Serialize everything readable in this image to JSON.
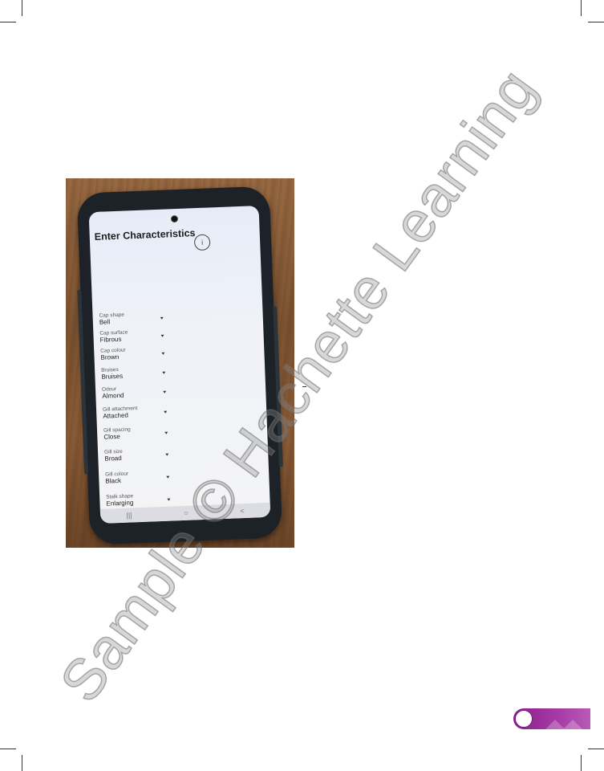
{
  "phone_screen": {
    "title": "Enter Characteristics",
    "info_icon": "info-icon",
    "fields": [
      {
        "label": "Cap shape",
        "value": "Bell"
      },
      {
        "label": "Cap surface",
        "value": "Fibrous"
      },
      {
        "label": "Cap colour",
        "value": "Brown"
      },
      {
        "label": "Bruises",
        "value": "Bruises"
      },
      {
        "label": "Odour",
        "value": "Almond"
      },
      {
        "label": "Gill attachment",
        "value": "Attached"
      },
      {
        "label": "Gill spacing",
        "value": "Close"
      },
      {
        "label": "Gill size",
        "value": "Broad"
      },
      {
        "label": "Gill colour",
        "value": "Black"
      },
      {
        "label": "Stalk shape",
        "value": "Enlarging"
      }
    ],
    "navbar": {
      "recents": "|||",
      "home": "○",
      "back": "<"
    }
  },
  "watermark": "Sample © Hachette Learning",
  "colors": {
    "accent": "#a83ba8"
  }
}
